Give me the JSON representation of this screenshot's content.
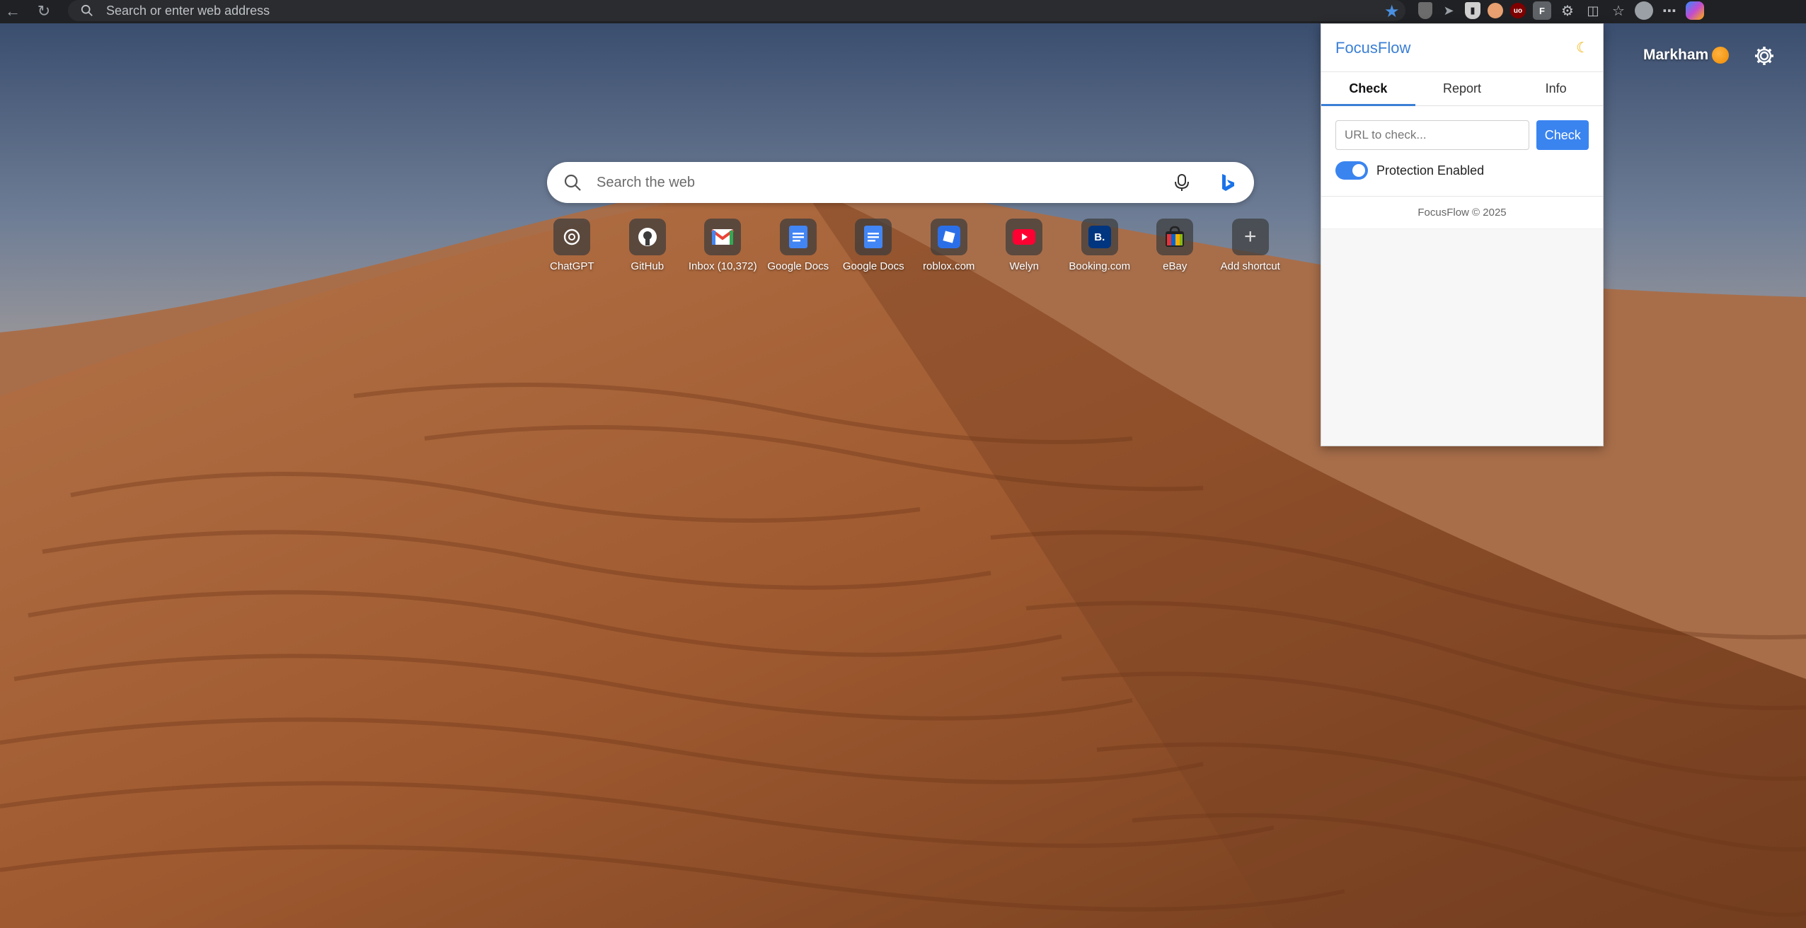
{
  "browser": {
    "address_placeholder": "Search or enter web address"
  },
  "search": {
    "placeholder": "Search the web"
  },
  "shortcuts": [
    {
      "label": "ChatGPT",
      "icon": "chatgpt-icon",
      "color": "#ffffff"
    },
    {
      "label": "GitHub",
      "icon": "github-icon",
      "color": "#ffffff"
    },
    {
      "label": "Inbox (10,372)",
      "icon": "gmail-icon",
      "color": "#ea4335"
    },
    {
      "label": "Google Docs",
      "icon": "google-docs-icon",
      "color": "#4285f4"
    },
    {
      "label": "Google Docs",
      "icon": "google-docs-icon",
      "color": "#4285f4"
    },
    {
      "label": "roblox.com",
      "icon": "roblox-icon",
      "color": "#2b6fe8"
    },
    {
      "label": "Welyn",
      "icon": "youtube-icon",
      "color": "#ff0033"
    },
    {
      "label": "Booking.com",
      "icon": "booking-icon",
      "color": "#003580"
    },
    {
      "label": "eBay",
      "icon": "ebay-icon",
      "color": "#e53238"
    },
    {
      "label": "Add shortcut",
      "icon": "plus-icon",
      "color": "#cccccc"
    }
  ],
  "profile": {
    "name": "Markham"
  },
  "popup": {
    "title": "FocusFlow",
    "tabs": [
      "Check",
      "Report",
      "Info"
    ],
    "active_tab": "Check",
    "url_placeholder": "URL to check...",
    "check_label": "Check",
    "toggle_label": "Protection Enabled",
    "toggle_on": true,
    "footer": "FocusFlow © 2025",
    "accent": "#3a84f0"
  },
  "booking_letter": "B."
}
